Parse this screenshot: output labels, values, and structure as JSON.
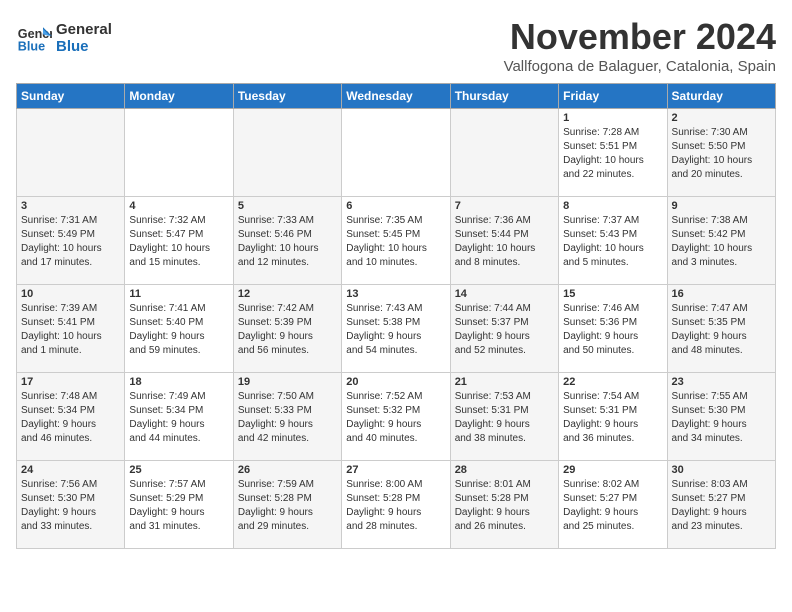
{
  "logo": {
    "line1": "General",
    "line2": "Blue"
  },
  "title": "November 2024",
  "location": "Vallfogona de Balaguer, Catalonia, Spain",
  "weekdays": [
    "Sunday",
    "Monday",
    "Tuesday",
    "Wednesday",
    "Thursday",
    "Friday",
    "Saturday"
  ],
  "weeks": [
    [
      {
        "day": "",
        "info": ""
      },
      {
        "day": "",
        "info": ""
      },
      {
        "day": "",
        "info": ""
      },
      {
        "day": "",
        "info": ""
      },
      {
        "day": "",
        "info": ""
      },
      {
        "day": "1",
        "info": "Sunrise: 7:28 AM\nSunset: 5:51 PM\nDaylight: 10 hours\nand 22 minutes."
      },
      {
        "day": "2",
        "info": "Sunrise: 7:30 AM\nSunset: 5:50 PM\nDaylight: 10 hours\nand 20 minutes."
      }
    ],
    [
      {
        "day": "3",
        "info": "Sunrise: 7:31 AM\nSunset: 5:49 PM\nDaylight: 10 hours\nand 17 minutes."
      },
      {
        "day": "4",
        "info": "Sunrise: 7:32 AM\nSunset: 5:47 PM\nDaylight: 10 hours\nand 15 minutes."
      },
      {
        "day": "5",
        "info": "Sunrise: 7:33 AM\nSunset: 5:46 PM\nDaylight: 10 hours\nand 12 minutes."
      },
      {
        "day": "6",
        "info": "Sunrise: 7:35 AM\nSunset: 5:45 PM\nDaylight: 10 hours\nand 10 minutes."
      },
      {
        "day": "7",
        "info": "Sunrise: 7:36 AM\nSunset: 5:44 PM\nDaylight: 10 hours\nand 8 minutes."
      },
      {
        "day": "8",
        "info": "Sunrise: 7:37 AM\nSunset: 5:43 PM\nDaylight: 10 hours\nand 5 minutes."
      },
      {
        "day": "9",
        "info": "Sunrise: 7:38 AM\nSunset: 5:42 PM\nDaylight: 10 hours\nand 3 minutes."
      }
    ],
    [
      {
        "day": "10",
        "info": "Sunrise: 7:39 AM\nSunset: 5:41 PM\nDaylight: 10 hours\nand 1 minute."
      },
      {
        "day": "11",
        "info": "Sunrise: 7:41 AM\nSunset: 5:40 PM\nDaylight: 9 hours\nand 59 minutes."
      },
      {
        "day": "12",
        "info": "Sunrise: 7:42 AM\nSunset: 5:39 PM\nDaylight: 9 hours\nand 56 minutes."
      },
      {
        "day": "13",
        "info": "Sunrise: 7:43 AM\nSunset: 5:38 PM\nDaylight: 9 hours\nand 54 minutes."
      },
      {
        "day": "14",
        "info": "Sunrise: 7:44 AM\nSunset: 5:37 PM\nDaylight: 9 hours\nand 52 minutes."
      },
      {
        "day": "15",
        "info": "Sunrise: 7:46 AM\nSunset: 5:36 PM\nDaylight: 9 hours\nand 50 minutes."
      },
      {
        "day": "16",
        "info": "Sunrise: 7:47 AM\nSunset: 5:35 PM\nDaylight: 9 hours\nand 48 minutes."
      }
    ],
    [
      {
        "day": "17",
        "info": "Sunrise: 7:48 AM\nSunset: 5:34 PM\nDaylight: 9 hours\nand 46 minutes."
      },
      {
        "day": "18",
        "info": "Sunrise: 7:49 AM\nSunset: 5:34 PM\nDaylight: 9 hours\nand 44 minutes."
      },
      {
        "day": "19",
        "info": "Sunrise: 7:50 AM\nSunset: 5:33 PM\nDaylight: 9 hours\nand 42 minutes."
      },
      {
        "day": "20",
        "info": "Sunrise: 7:52 AM\nSunset: 5:32 PM\nDaylight: 9 hours\nand 40 minutes."
      },
      {
        "day": "21",
        "info": "Sunrise: 7:53 AM\nSunset: 5:31 PM\nDaylight: 9 hours\nand 38 minutes."
      },
      {
        "day": "22",
        "info": "Sunrise: 7:54 AM\nSunset: 5:31 PM\nDaylight: 9 hours\nand 36 minutes."
      },
      {
        "day": "23",
        "info": "Sunrise: 7:55 AM\nSunset: 5:30 PM\nDaylight: 9 hours\nand 34 minutes."
      }
    ],
    [
      {
        "day": "24",
        "info": "Sunrise: 7:56 AM\nSunset: 5:30 PM\nDaylight: 9 hours\nand 33 minutes."
      },
      {
        "day": "25",
        "info": "Sunrise: 7:57 AM\nSunset: 5:29 PM\nDaylight: 9 hours\nand 31 minutes."
      },
      {
        "day": "26",
        "info": "Sunrise: 7:59 AM\nSunset: 5:28 PM\nDaylight: 9 hours\nand 29 minutes."
      },
      {
        "day": "27",
        "info": "Sunrise: 8:00 AM\nSunset: 5:28 PM\nDaylight: 9 hours\nand 28 minutes."
      },
      {
        "day": "28",
        "info": "Sunrise: 8:01 AM\nSunset: 5:28 PM\nDaylight: 9 hours\nand 26 minutes."
      },
      {
        "day": "29",
        "info": "Sunrise: 8:02 AM\nSunset: 5:27 PM\nDaylight: 9 hours\nand 25 minutes."
      },
      {
        "day": "30",
        "info": "Sunrise: 8:03 AM\nSunset: 5:27 PM\nDaylight: 9 hours\nand 23 minutes."
      }
    ]
  ]
}
